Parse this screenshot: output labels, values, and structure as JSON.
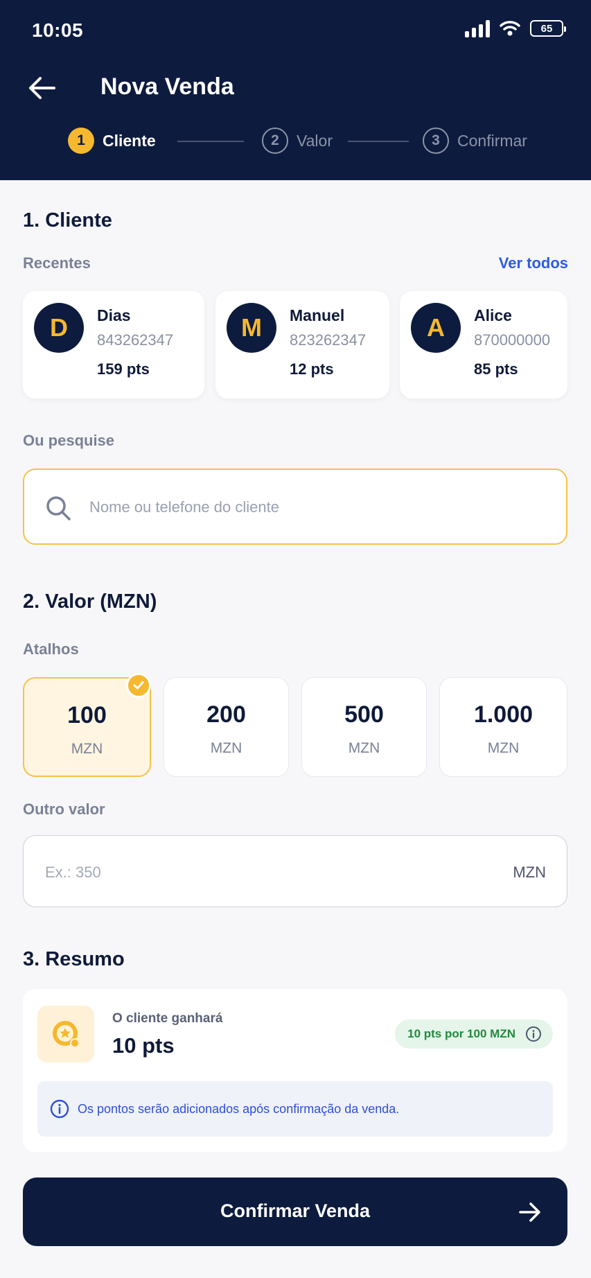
{
  "status_bar": {
    "time": "10:05",
    "battery": "65"
  },
  "header": {
    "title": "Nova Venda"
  },
  "steps": [
    {
      "num": "1",
      "label": "Cliente"
    },
    {
      "num": "2",
      "label": "Valor"
    },
    {
      "num": "3",
      "label": "Confirmar"
    }
  ],
  "client_section": {
    "title": "1. Cliente",
    "recent_label": "Recentes",
    "see_all": "Ver todos",
    "recent": [
      {
        "initial": "D",
        "name": "Dias",
        "phone": "843262347",
        "points": "159 pts"
      },
      {
        "initial": "M",
        "name": "Manuel",
        "phone": "823262347",
        "points": "12 pts"
      },
      {
        "initial": "A",
        "name": "Alice",
        "phone": "870000000",
        "points": "85 pts"
      }
    ],
    "search_label": "Ou pesquise",
    "search_placeholder": "Nome ou telefone do cliente"
  },
  "value_section": {
    "title": "2. Valor (MZN)",
    "shortcuts_label": "Atalhos",
    "shortcuts": [
      {
        "value": "100",
        "unit": "MZN",
        "selected": true
      },
      {
        "value": "200",
        "unit": "MZN",
        "selected": false
      },
      {
        "value": "500",
        "unit": "MZN",
        "selected": false
      },
      {
        "value": "1.000",
        "unit": "MZN",
        "selected": false
      }
    ],
    "other_label": "Outro valor",
    "other_placeholder": "Ex.: 350",
    "other_currency": "MZN"
  },
  "summary_section": {
    "title": "3. Resumo",
    "gain_label": "O cliente ganhará",
    "gain_value": "10 pts",
    "rate": "10 pts por 100 MZN",
    "info": "Os pontos serão adicionados após confirmação da venda."
  },
  "cta": {
    "label": "Confirmar Venda"
  },
  "colors": {
    "navy": "#0d1b3e",
    "accent": "#f5b82e",
    "link": "#2d5be3",
    "success": "#1f8a3e"
  }
}
